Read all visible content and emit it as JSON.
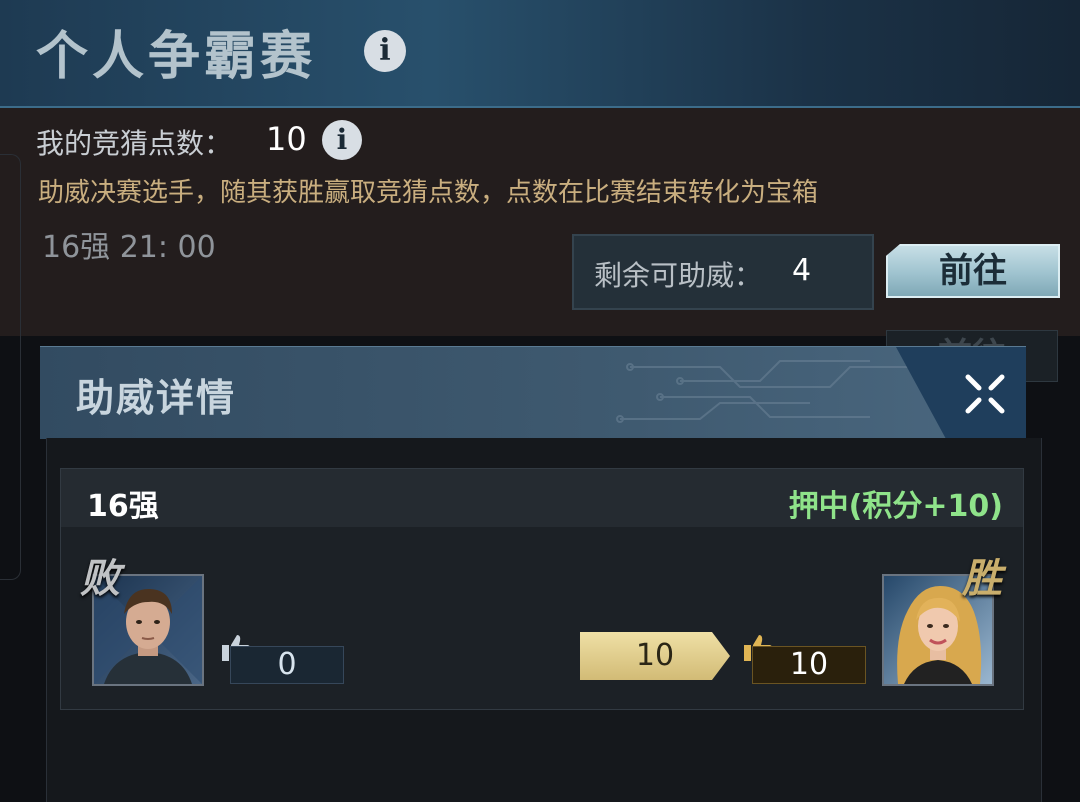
{
  "banner": {
    "title": "个人争霸赛",
    "info_glyph": "i"
  },
  "guess": {
    "points_label": "我的竞猜点数：",
    "points_value": "10",
    "info_glyph": "i",
    "description": "助威决赛选手，随其获胜赢取竞猜点数，点数在比赛结束转化为宝箱",
    "round_time": "16强 21: 00",
    "remaining_label": "剩余可助威：",
    "remaining_value": "4",
    "goto_label": "前往",
    "goto_ghost_label": "前往"
  },
  "popup": {
    "title": "助威详情",
    "close_icon": "close-icon"
  },
  "match": {
    "round": "16强",
    "result": "押中(积分+10)",
    "left": {
      "tag": "败",
      "votes": "0",
      "avatar_icon": "male-soldier-portrait"
    },
    "right": {
      "tag": "胜",
      "votes": "10",
      "my_support": "10",
      "avatar_icon": "blonde-woman-portrait"
    }
  },
  "colors": {
    "banner": "#28506c",
    "desc_gold": "#c9ae7f",
    "win_green": "#8fe38a",
    "goto_button": "#9fc3cf",
    "support_gold": "#d2bb76"
  }
}
